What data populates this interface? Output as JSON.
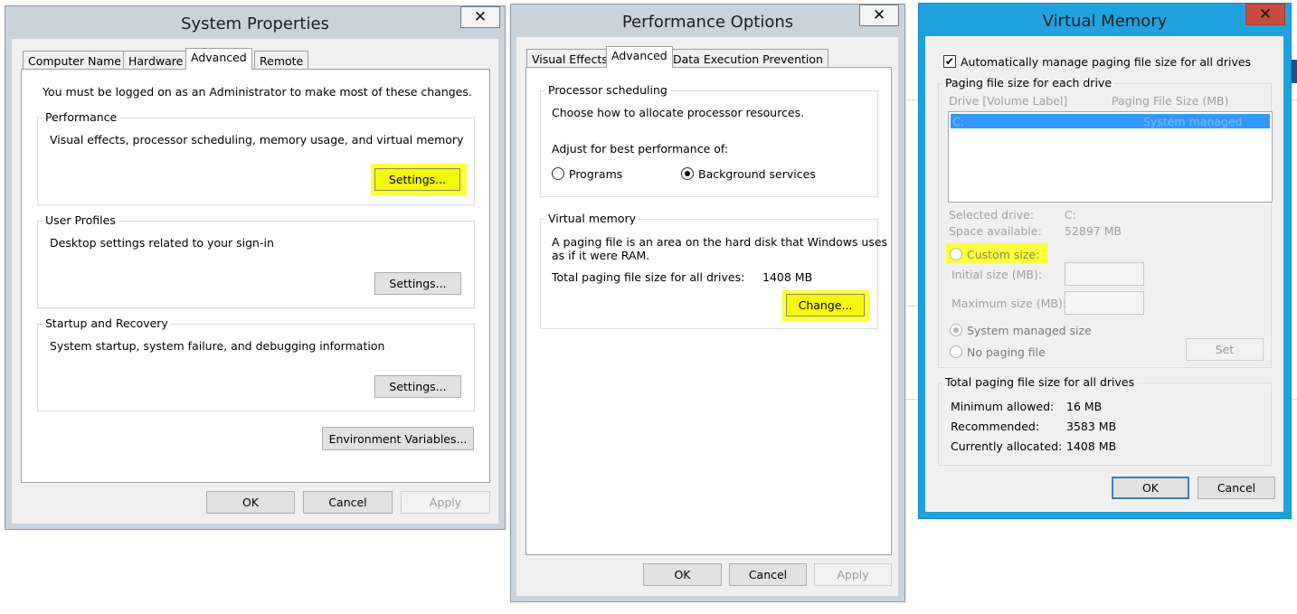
{
  "system_properties": {
    "title": "System Properties",
    "close_glyph": "✕",
    "tabs": [
      "Computer Name",
      "Hardware",
      "Advanced",
      "Remote"
    ],
    "active_tab": "Advanced",
    "admin_note": "You must be logged on as an Administrator to make most of these changes.",
    "performance": {
      "label": "Performance",
      "desc": "Visual effects, processor scheduling, memory usage, and virtual memory",
      "button": "Settings..."
    },
    "user_profiles": {
      "label": "User Profiles",
      "desc": "Desktop settings related to your sign-in",
      "button": "Settings..."
    },
    "startup_recovery": {
      "label": "Startup and Recovery",
      "desc": "System startup, system failure, and debugging information",
      "button": "Settings..."
    },
    "env_button": "Environment Variables...",
    "ok": "OK",
    "cancel": "Cancel",
    "apply": "Apply"
  },
  "performance_options": {
    "title": "Performance Options",
    "close_glyph": "✕",
    "tabs": [
      "Visual Effects",
      "Advanced",
      "Data Execution Prevention"
    ],
    "active_tab": "Advanced",
    "processor": {
      "label": "Processor scheduling",
      "desc": "Choose how to allocate processor resources.",
      "adjust": "Adjust for best performance of:",
      "option_programs": "Programs",
      "option_background": "Background services",
      "selected": "Background services"
    },
    "virtual_memory": {
      "label": "Virtual memory",
      "desc_line1": "A paging file is an area on the hard disk that Windows uses",
      "desc_line2": "as if it were RAM.",
      "total_label": "Total paging file size for all drives:",
      "total_value": "1408 MB",
      "change_button": "Change..."
    },
    "ok": "OK",
    "cancel": "Cancel",
    "apply": "Apply"
  },
  "virtual_memory": {
    "title": "Virtual Memory",
    "close_glyph": "✕",
    "auto_manage": {
      "label": "Automatically manage paging file size for all drives",
      "checked": true,
      "glyph": "✔"
    },
    "per_drive_label": "Paging file size for each drive",
    "col_drive": "Drive  [Volume Label]",
    "col_size": "Paging File Size (MB)",
    "drives": [
      {
        "drive": "C:",
        "size": "System managed"
      }
    ],
    "selected_drive_label": "Selected drive:",
    "selected_drive_value": "C:",
    "space_label": "Space available:",
    "space_value": "52897 MB",
    "custom_size": "Custom size:",
    "initial_label": "Initial size (MB):",
    "maximum_label": "Maximum size (MB):",
    "initial_value": "",
    "maximum_value": "",
    "system_managed": "System managed size",
    "no_paging": "No paging file",
    "set_button": "Set",
    "totals": {
      "label": "Total paging file size for all drives",
      "min_label": "Minimum allowed:",
      "min_value": "16 MB",
      "rec_label": "Recommended:",
      "rec_value": "3583 MB",
      "cur_label": "Currently allocated:",
      "cur_value": "1408 MB"
    },
    "ok": "OK",
    "cancel": "Cancel"
  },
  "colors": {
    "highlight": "#ffff3a",
    "selection_blue": "#3399ff",
    "active_window_frame": "#20a2df",
    "inactive_window_frame": "#c8d3dc",
    "close_red": "#c74c3c"
  }
}
